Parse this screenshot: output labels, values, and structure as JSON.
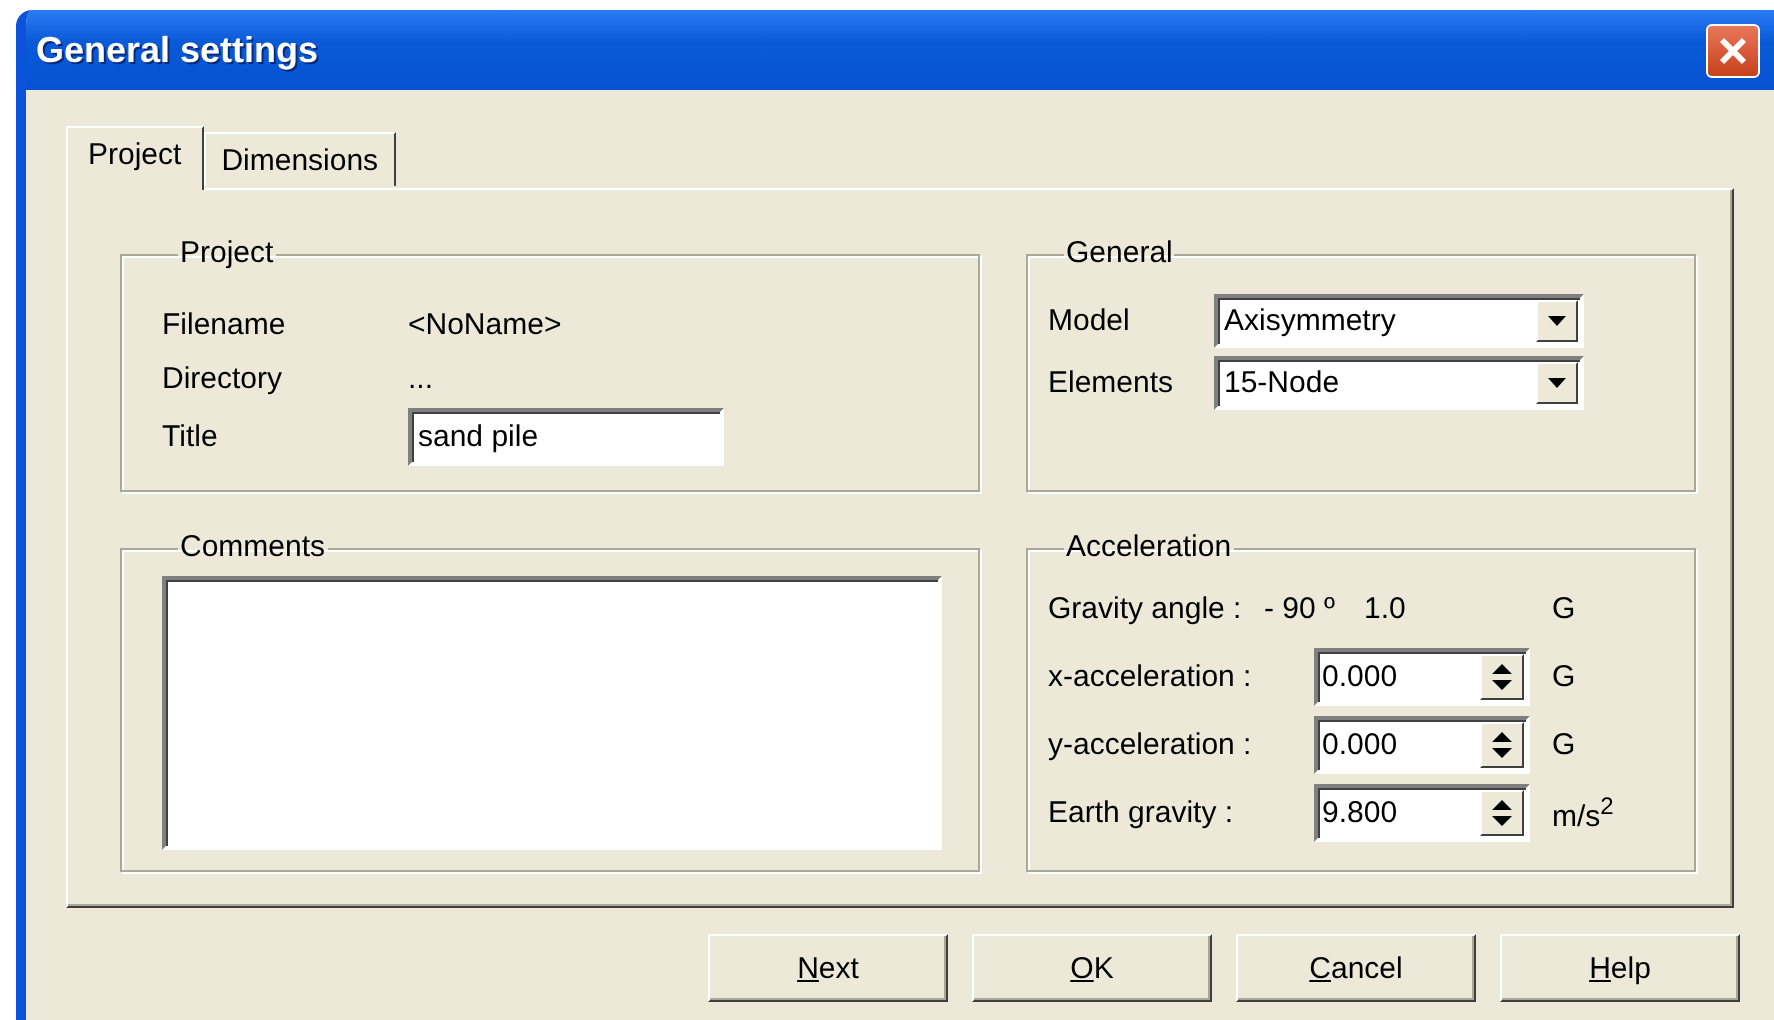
{
  "window": {
    "title": "General settings"
  },
  "tabs": [
    {
      "label": "Project",
      "selected": true
    },
    {
      "label": "Dimensions",
      "selected": false
    }
  ],
  "project": {
    "title": "Project",
    "rows": [
      {
        "kind": "info",
        "label": "Filename",
        "value": "<NoName>"
      },
      {
        "kind": "info",
        "label": "Directory",
        "value": "..."
      },
      {
        "kind": "input",
        "label": "Title",
        "value": "sand pile"
      }
    ]
  },
  "general": {
    "title": "General",
    "rows": [
      {
        "label": "Model",
        "value": "Axisymmetry"
      },
      {
        "label": "Elements",
        "value": "15-Node"
      }
    ]
  },
  "comments": {
    "title": "Comments"
  },
  "acceleration": {
    "title": "Acceleration",
    "rows": [
      {
        "kind": "readout",
        "label": "Gravity angle :",
        "angle": "- 90 º",
        "magnitude": "1.0",
        "unit": "G"
      },
      {
        "kind": "spin",
        "label": "x-acceleration :",
        "value": "0.000",
        "unit": "G"
      },
      {
        "kind": "spin",
        "label": "y-acceleration :",
        "value": "0.000",
        "unit": "G"
      },
      {
        "kind": "spin",
        "label": "Earth gravity :",
        "value": "9.800",
        "unit": "m/s$^{2}$"
      }
    ]
  },
  "buttons": [
    {
      "access_key": "N",
      "rest": "ext"
    },
    {
      "access_key": "O",
      "rest": "K"
    },
    {
      "access_key": "C",
      "rest": "ancel"
    },
    {
      "access_key": "H",
      "rest": "elp"
    }
  ]
}
